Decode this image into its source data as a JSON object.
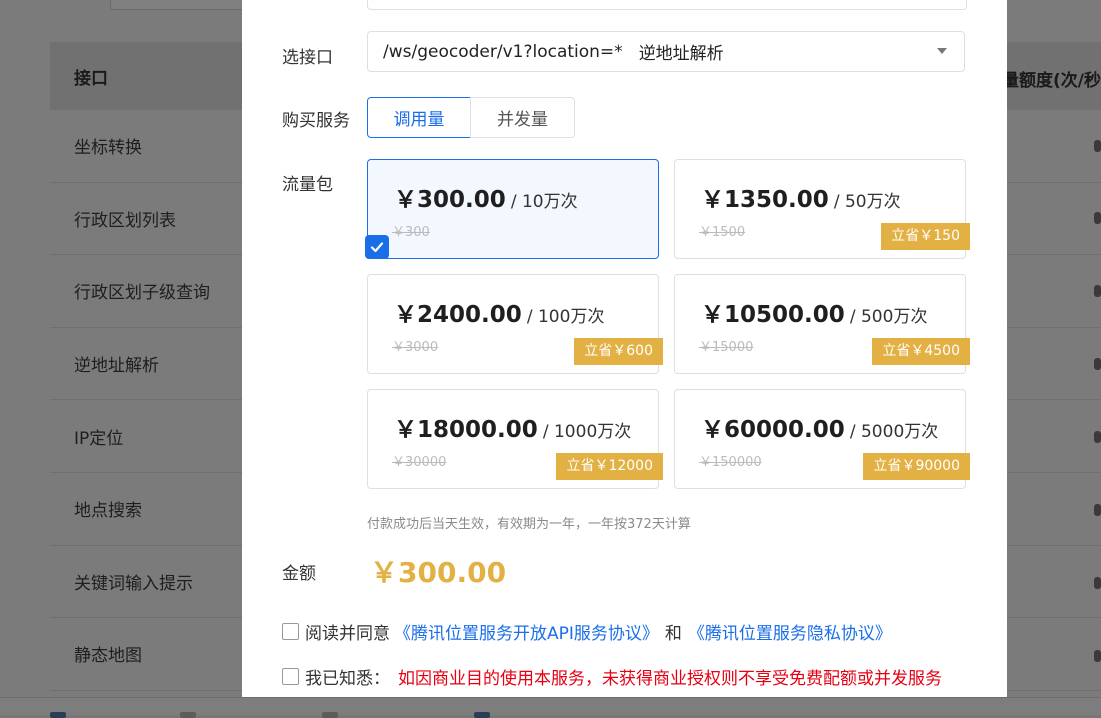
{
  "background": {
    "table_header": "接口",
    "right_header": "量额度(次/秒",
    "rows": [
      "坐标转换",
      "行政区划列表",
      "行政区划子级查询",
      "逆地址解析",
      "IP定位",
      "地点搜索",
      "关键词输入提示",
      "静态地图"
    ]
  },
  "dialog": {
    "api_label": "选接口",
    "api_path": "/ws/geocoder/v1?location=*",
    "api_name": "逆地址解析",
    "service_label": "购买服务",
    "service_options": [
      "调用量",
      "并发量"
    ],
    "selected_service": "调用量",
    "package_label": "流量包",
    "packages": [
      {
        "price": "￥300.00",
        "unit": "/ 10万次",
        "original": "￥300",
        "save": "",
        "selected": true
      },
      {
        "price": "￥1350.00",
        "unit": "/ 50万次",
        "original": "￥1500",
        "save": "立省￥150",
        "selected": false
      },
      {
        "price": "￥2400.00",
        "unit": "/ 100万次",
        "original": "￥3000",
        "save": "立省￥600",
        "selected": false
      },
      {
        "price": "￥10500.00",
        "unit": "/ 500万次",
        "original": "￥15000",
        "save": "立省￥4500",
        "selected": false
      },
      {
        "price": "￥18000.00",
        "unit": "/ 1000万次",
        "original": "￥30000",
        "save": "立省￥12000",
        "selected": false
      },
      {
        "price": "￥60000.00",
        "unit": "/ 5000万次",
        "original": "￥150000",
        "save": "立省￥90000",
        "selected": false
      }
    ],
    "validity_note": "付款成功后当天生效，有效期为一年，一年按372天计算",
    "amount_label": "金额",
    "amount_value": "￥300.00",
    "agreement": {
      "prefix": "阅读并同意",
      "link1": "《腾讯位置服务开放API服务协议》",
      "and": "和",
      "link2": "《腾讯位置服务隐私协议》"
    },
    "notice": {
      "prefix": "我已知悉：",
      "warning": "如因商业目的使用本服务，未获得商业授权则不享受免费配额或并发服务"
    }
  },
  "colors": {
    "accent": "#1a6fe8",
    "gold": "#e3b043",
    "warning": "#e60012"
  }
}
